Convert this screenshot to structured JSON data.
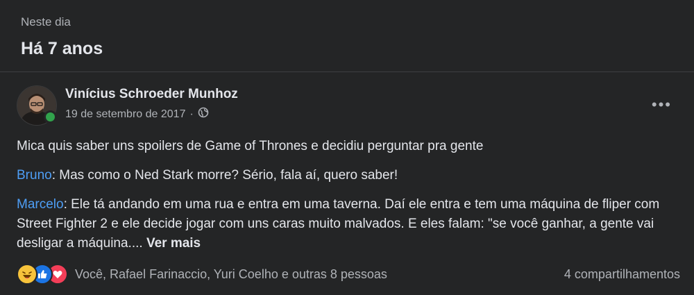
{
  "header": {
    "eyebrow": "Neste dia",
    "title": "Há 7 anos"
  },
  "post": {
    "author": "Vinícius Schroeder Munhoz",
    "date": "19 de setembro de 2017",
    "separator": "·",
    "privacy_icon": "globe-icon",
    "more_label": "•••",
    "intro": "Mica quis saber uns spoilers de Game of Thrones e decidiu perguntar pra gente",
    "lines": [
      {
        "speaker": "Bruno",
        "text": ": Mas como o Ned Stark morre? Sério, fala aí, quero saber!"
      },
      {
        "speaker": "Marcelo",
        "text": ": Ele tá andando em uma rua e entra em uma taverna. Daí ele entra e tem uma máquina de fliper com Street Fighter 2 e ele decide jogar com uns caras muito malvados. E eles falam: \"se você ganhar, a gente vai desligar a máquina.... "
      }
    ],
    "see_more": "Ver mais"
  },
  "footer": {
    "reactions": [
      "haha-icon",
      "like-icon",
      "love-icon"
    ],
    "reactors": "Você, Rafael Farinaccio, Yuri Coelho e outras 8 pessoas",
    "shares": "4 compartilhamentos"
  },
  "colors": {
    "background": "#242526",
    "speaker": "#4e9ef5",
    "online": "#31a24c"
  }
}
